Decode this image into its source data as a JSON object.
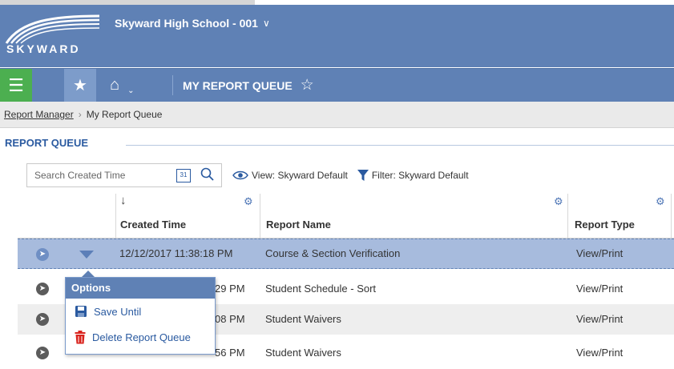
{
  "header": {
    "logo_text": "SKYWARD",
    "school": "Skyward High School - 001",
    "school_chevron": "∨"
  },
  "nav": {
    "menu_icon": "☰",
    "favorite_icon": "★",
    "home_icon": "⌂",
    "home_dropdown": "⌵",
    "title": "MY REPORT QUEUE",
    "title_star": "☆"
  },
  "breadcrumb": {
    "parent": "Report Manager",
    "separator": "›",
    "current": "My Report Queue"
  },
  "section": {
    "title": "REPORT QUEUE"
  },
  "toolbar": {
    "search_placeholder": "Search Created Time",
    "calendar_label": "31",
    "view_label": "View: Skyward Default",
    "filter_label": "Filter: Skyward Default"
  },
  "grid": {
    "sort_arrow": "↓",
    "columns": [
      "Created Time",
      "Report Name",
      "Report Type"
    ],
    "gear_icon": "⚙",
    "rows": [
      {
        "created": "12/12/2017 11:38:18 PM",
        "name": "Course & Section Verification",
        "type": "View/Print"
      },
      {
        "created": "29 PM",
        "name": "Student Schedule - Sort",
        "type": "View/Print"
      },
      {
        "created": "08 PM",
        "name": "Student Waivers",
        "type": "View/Print"
      },
      {
        "created": "56 PM",
        "name": "Student Waivers",
        "type": "View/Print"
      }
    ]
  },
  "popup": {
    "title": "Options",
    "items": [
      {
        "label": "Save Until",
        "icon": "save-icon"
      },
      {
        "label": "Delete Report Queue",
        "icon": "trash-icon"
      }
    ]
  },
  "colors": {
    "header_blue": "#5f81b5",
    "menu_green": "#4caf50",
    "selected_row": "#a7bbdd",
    "link_blue": "#2a5aa0",
    "delete_red": "#d9231d"
  }
}
